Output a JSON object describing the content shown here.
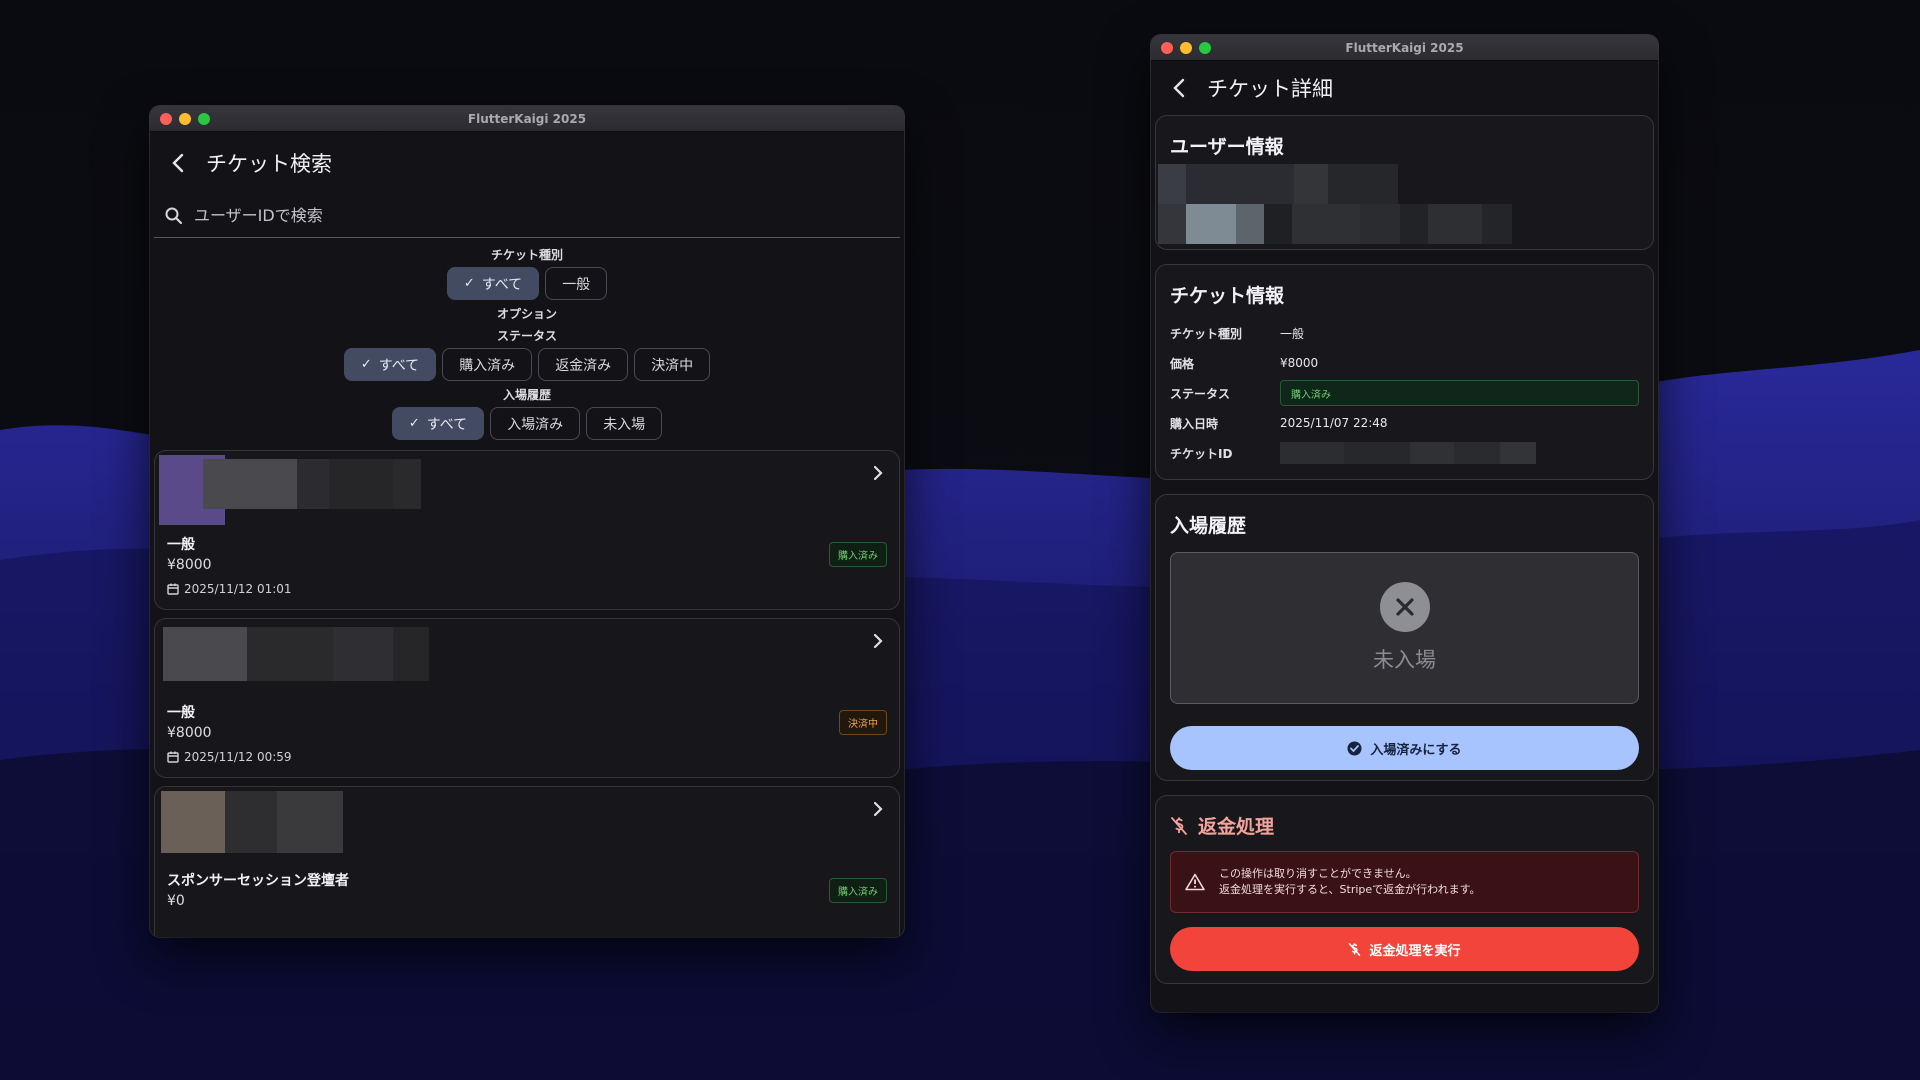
{
  "left_window": {
    "title": "FlutterKaigi 2025",
    "page_title": "チケット検索",
    "search": {
      "placeholder": "ユーザーIDで検索"
    },
    "filters": {
      "ticket_type": {
        "label": "チケット種別",
        "chips": [
          "すべて",
          "一般"
        ],
        "selected": "すべて"
      },
      "option_label": "オプション",
      "status": {
        "label": "ステータス",
        "chips": [
          "すべて",
          "購入済み",
          "返金済み",
          "決済中"
        ],
        "selected": "すべて"
      },
      "entry": {
        "label": "入場履歴",
        "chips": [
          "すべて",
          "入場済み",
          "未入場"
        ],
        "selected": "すべて"
      }
    },
    "tickets": [
      {
        "type": "一般",
        "price": "¥8000",
        "date": "2025/11/12 01:01",
        "status": "購入済み"
      },
      {
        "type": "一般",
        "price": "¥8000",
        "date": "2025/11/12 00:59",
        "status": "決済中"
      },
      {
        "type": "スポンサーセッション登壇者",
        "price": "¥0",
        "date": "",
        "status": "購入済み"
      }
    ]
  },
  "right_window": {
    "title": "FlutterKaigi 2025",
    "page_title": "チケット詳細",
    "user_info": {
      "title": "ユーザー情報"
    },
    "ticket_info": {
      "title": "チケット情報",
      "rows": {
        "type": {
          "label": "チケット種別",
          "value": "一般"
        },
        "price": {
          "label": "価格",
          "value": "¥8000"
        },
        "status": {
          "label": "ステータス",
          "value": "購入済み"
        },
        "purchased_at": {
          "label": "購入日時",
          "value": "2025/11/07 22:48"
        },
        "ticket_id": {
          "label": "チケットID"
        }
      }
    },
    "entry_history": {
      "title": "入場履歴",
      "state": "未入場",
      "button": "入場済みにする"
    },
    "refund": {
      "title": "返金処理",
      "warning_line1": "この操作は取り消すことができません。",
      "warning_line2": "返金処理を実行すると、Stripeで返金が行われます。",
      "button": "返金処理を実行"
    }
  },
  "colors": {
    "accent_light_blue": "#a8c4ff",
    "danger_red": "#f2443a",
    "success_green": "#6fcf6f",
    "warning_orange": "#f0a24a",
    "selected_chip": "#434b62"
  },
  "icons": [
    "back-arrow-icon",
    "search-icon",
    "check-icon",
    "chevron-right-icon",
    "calendar-icon",
    "close-x-icon",
    "check-circle-icon",
    "money-off-icon",
    "warning-triangle-icon"
  ]
}
